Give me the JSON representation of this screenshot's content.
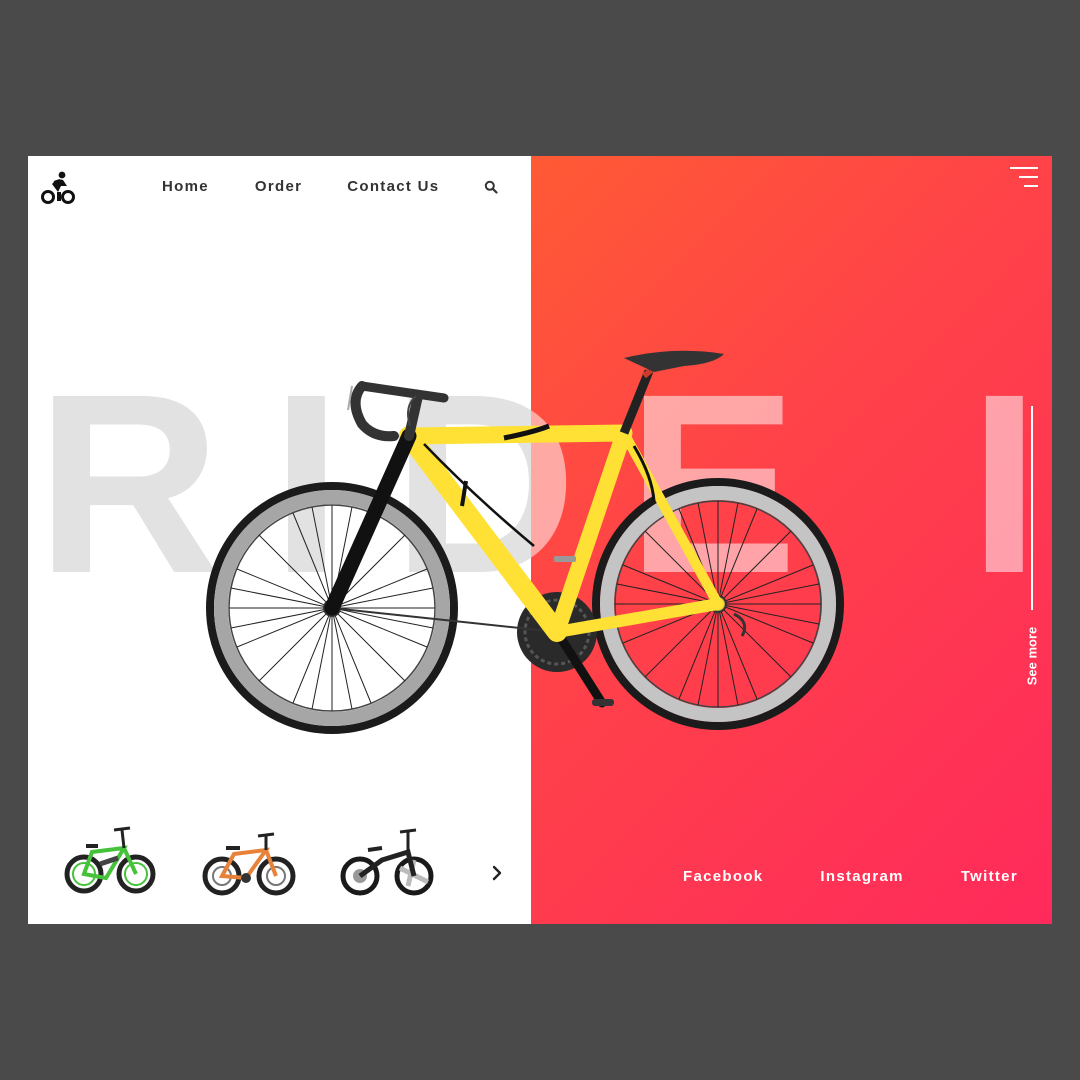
{
  "nav": {
    "home": "Home",
    "order": "Order",
    "contact": "Contact Us"
  },
  "icons": {
    "logo": "cyclist-icon",
    "search": "search-icon",
    "menu": "hamburger-menu-icon",
    "next": "chevron-right-icon"
  },
  "hero": {
    "headline": "RIDE IT",
    "see_more": "See more"
  },
  "thumbnails": [
    {
      "name": "bike-thumbnail-green",
      "accent": "#45c23a"
    },
    {
      "name": "bike-thumbnail-orange",
      "accent": "#e8823a"
    },
    {
      "name": "bike-thumbnail-black",
      "accent": "#222222"
    }
  ],
  "social": {
    "facebook": "Facebook",
    "instagram": "Instagram",
    "twitter": "Twitter"
  },
  "colors": {
    "background": "#4a4a4a",
    "gradient_start": "#ff5a35",
    "gradient_end": "#ff2a5c",
    "bike_frame": "#ffe135"
  }
}
